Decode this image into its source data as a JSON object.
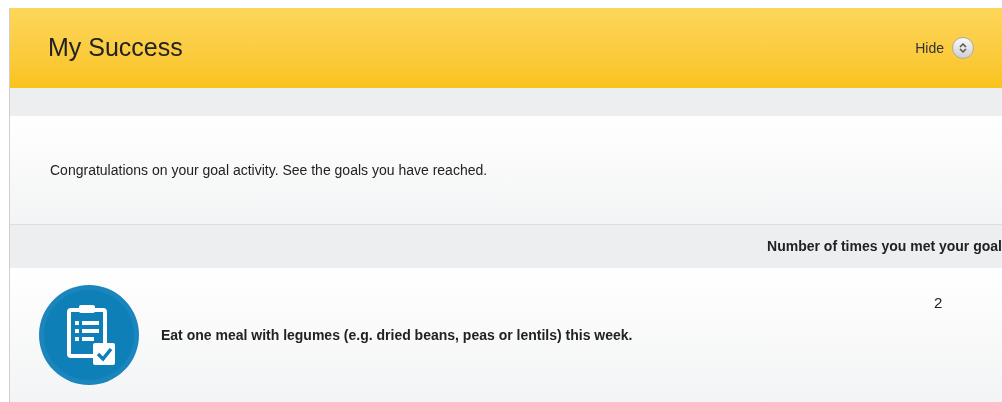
{
  "header": {
    "title": "My Success",
    "toggle_label": "Hide"
  },
  "message": "Congratulations on your goal activity. See the goals you have reached.",
  "table": {
    "columns": [
      "Number of times you met your goal"
    ],
    "rows": [
      {
        "goal": "Eat one meal with legumes (e.g. dried beans, peas or lentils) this week.",
        "count": "2"
      }
    ]
  }
}
